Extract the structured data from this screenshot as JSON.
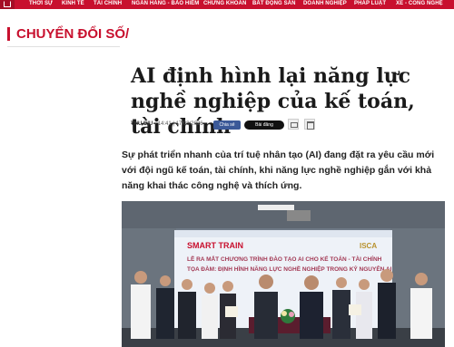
{
  "nav": {
    "items": [
      "THỜI SỰ",
      "KINH TẾ",
      "TÀI CHÍNH",
      "NGÂN HÀNG - BẢO HIỂM",
      "CHỨNG KHOÁN",
      "BẤT ĐỘNG SẢN",
      "DOANH NGHIỆP",
      "PHÁP LUẬT",
      "XE - CÔNG NGHỆ"
    ]
  },
  "section": {
    "title": "CHUYỂN ĐỔI SỐ/"
  },
  "article": {
    "title": "AI định hình lại năng lực nghề nghiệp của kế toán, tài chính",
    "author": "THU DỊU",
    "datetime": "- 14:41 | 17/08/2026",
    "share_fb": "Chia sẻ",
    "share_x": "Bài đăng",
    "sapo": "Sự phát triển nhanh của trí tuệ nhân tạo (AI) đang đặt ra yêu cầu mới với đội ngũ kế toán, tài chính, khi năng lực nghề nghiệp gắn với khả năng khai thác công nghệ và thích ứng."
  },
  "photo": {
    "logo_left": "SMART TRAIN",
    "logo_right": "ISCA",
    "banner_line1": "LỄ RA MẮT CHƯƠNG TRÌNH ĐÀO TẠO AI CHO KẾ TOÁN - TÀI CHÍNH",
    "banner_line2": "TỌA ĐÀM: ĐỊNH HÌNH NĂNG LỰC NGHỀ NGHIỆP TRONG KỶ NGUYÊN AI"
  },
  "colors": {
    "brand": "#c8102e",
    "fb": "#3b5998"
  },
  "icons": [
    "home-icon",
    "mail-icon",
    "print-icon"
  ]
}
